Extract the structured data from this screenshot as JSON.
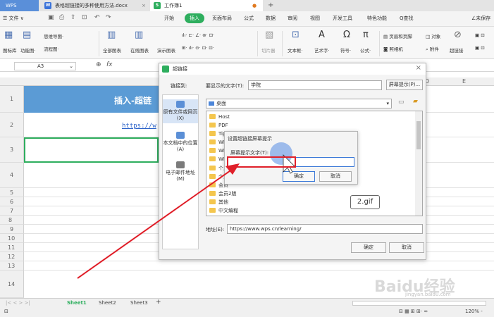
{
  "tabs": {
    "app": "WPS",
    "doc1": "表格超链接的多种使用方法.docx",
    "doc2": "工作簿1",
    "add": "+"
  },
  "menu": {
    "file": "☰ 文件 ∨",
    "items": [
      "开始",
      "插入",
      "页面布局",
      "公式",
      "数据",
      "审阅",
      "视图",
      "开发工具",
      "特色功能"
    ],
    "active": "插入",
    "search": "Q查找",
    "save": "∠未保存"
  },
  "ribbon": {
    "gallery": "图标库",
    "funcmap": "功能图·",
    "mindmap": "思维导图·",
    "flowchart": "流程图·",
    "allchart": "全部图表",
    "onlinechart": "在线图表",
    "demochart": "演示图表",
    "slicer": "切片器",
    "textbox": "文本框·",
    "arttext": "艺术字·",
    "symbol": "符号·",
    "formula": "公式·",
    "headerfooter": "页眉和页脚",
    "object": "对象",
    "camera": "照相机",
    "attach": "附件",
    "hyperlink": "超链接"
  },
  "formula_bar": {
    "cell": "A3",
    "fx": "fx"
  },
  "grid": {
    "rows": [
      "1",
      "2",
      "3",
      "4",
      "5",
      "6",
      "7",
      "8",
      "9",
      "10",
      "11",
      "12",
      "13",
      "14"
    ],
    "col_d": "D",
    "col_e": "E",
    "title": "插入-超链",
    "link": "https://w"
  },
  "sheets": [
    "Sheet1",
    "Sheet2",
    "Sheet3"
  ],
  "status": {
    "zoom": "120% -"
  },
  "dialog": {
    "title": "超链接",
    "link_to": "链接到:",
    "display_label": "要显示的文字(T):",
    "display_value": "学院",
    "screen_tip_btn": "屏幕提示(P)...",
    "location": "桌面",
    "sidebar": [
      "原有文件或网页(X)",
      "本文档中的位置(A)",
      "电子邮件地址(M)"
    ],
    "files": [
      "Host",
      "PDF",
      "Tip",
      "WP",
      "WP",
      "WP",
      "个人",
      "个人",
      "会员",
      "会员2版",
      "其他",
      "中文编程"
    ],
    "address_label": "地址(E):",
    "address_value": "https://www.wps.cn/learning/",
    "ok": "确定",
    "cancel": "取消"
  },
  "tip_dialog": {
    "title": "设置超链接屏幕提示",
    "label": "屏幕提示文字(T):",
    "value": "",
    "ok": "确定",
    "cancel": "取消"
  },
  "overlay": {
    "gif": "2.gif",
    "watermark": "Baidu经验",
    "watermark_sub": "jingyan.baidu.com"
  }
}
